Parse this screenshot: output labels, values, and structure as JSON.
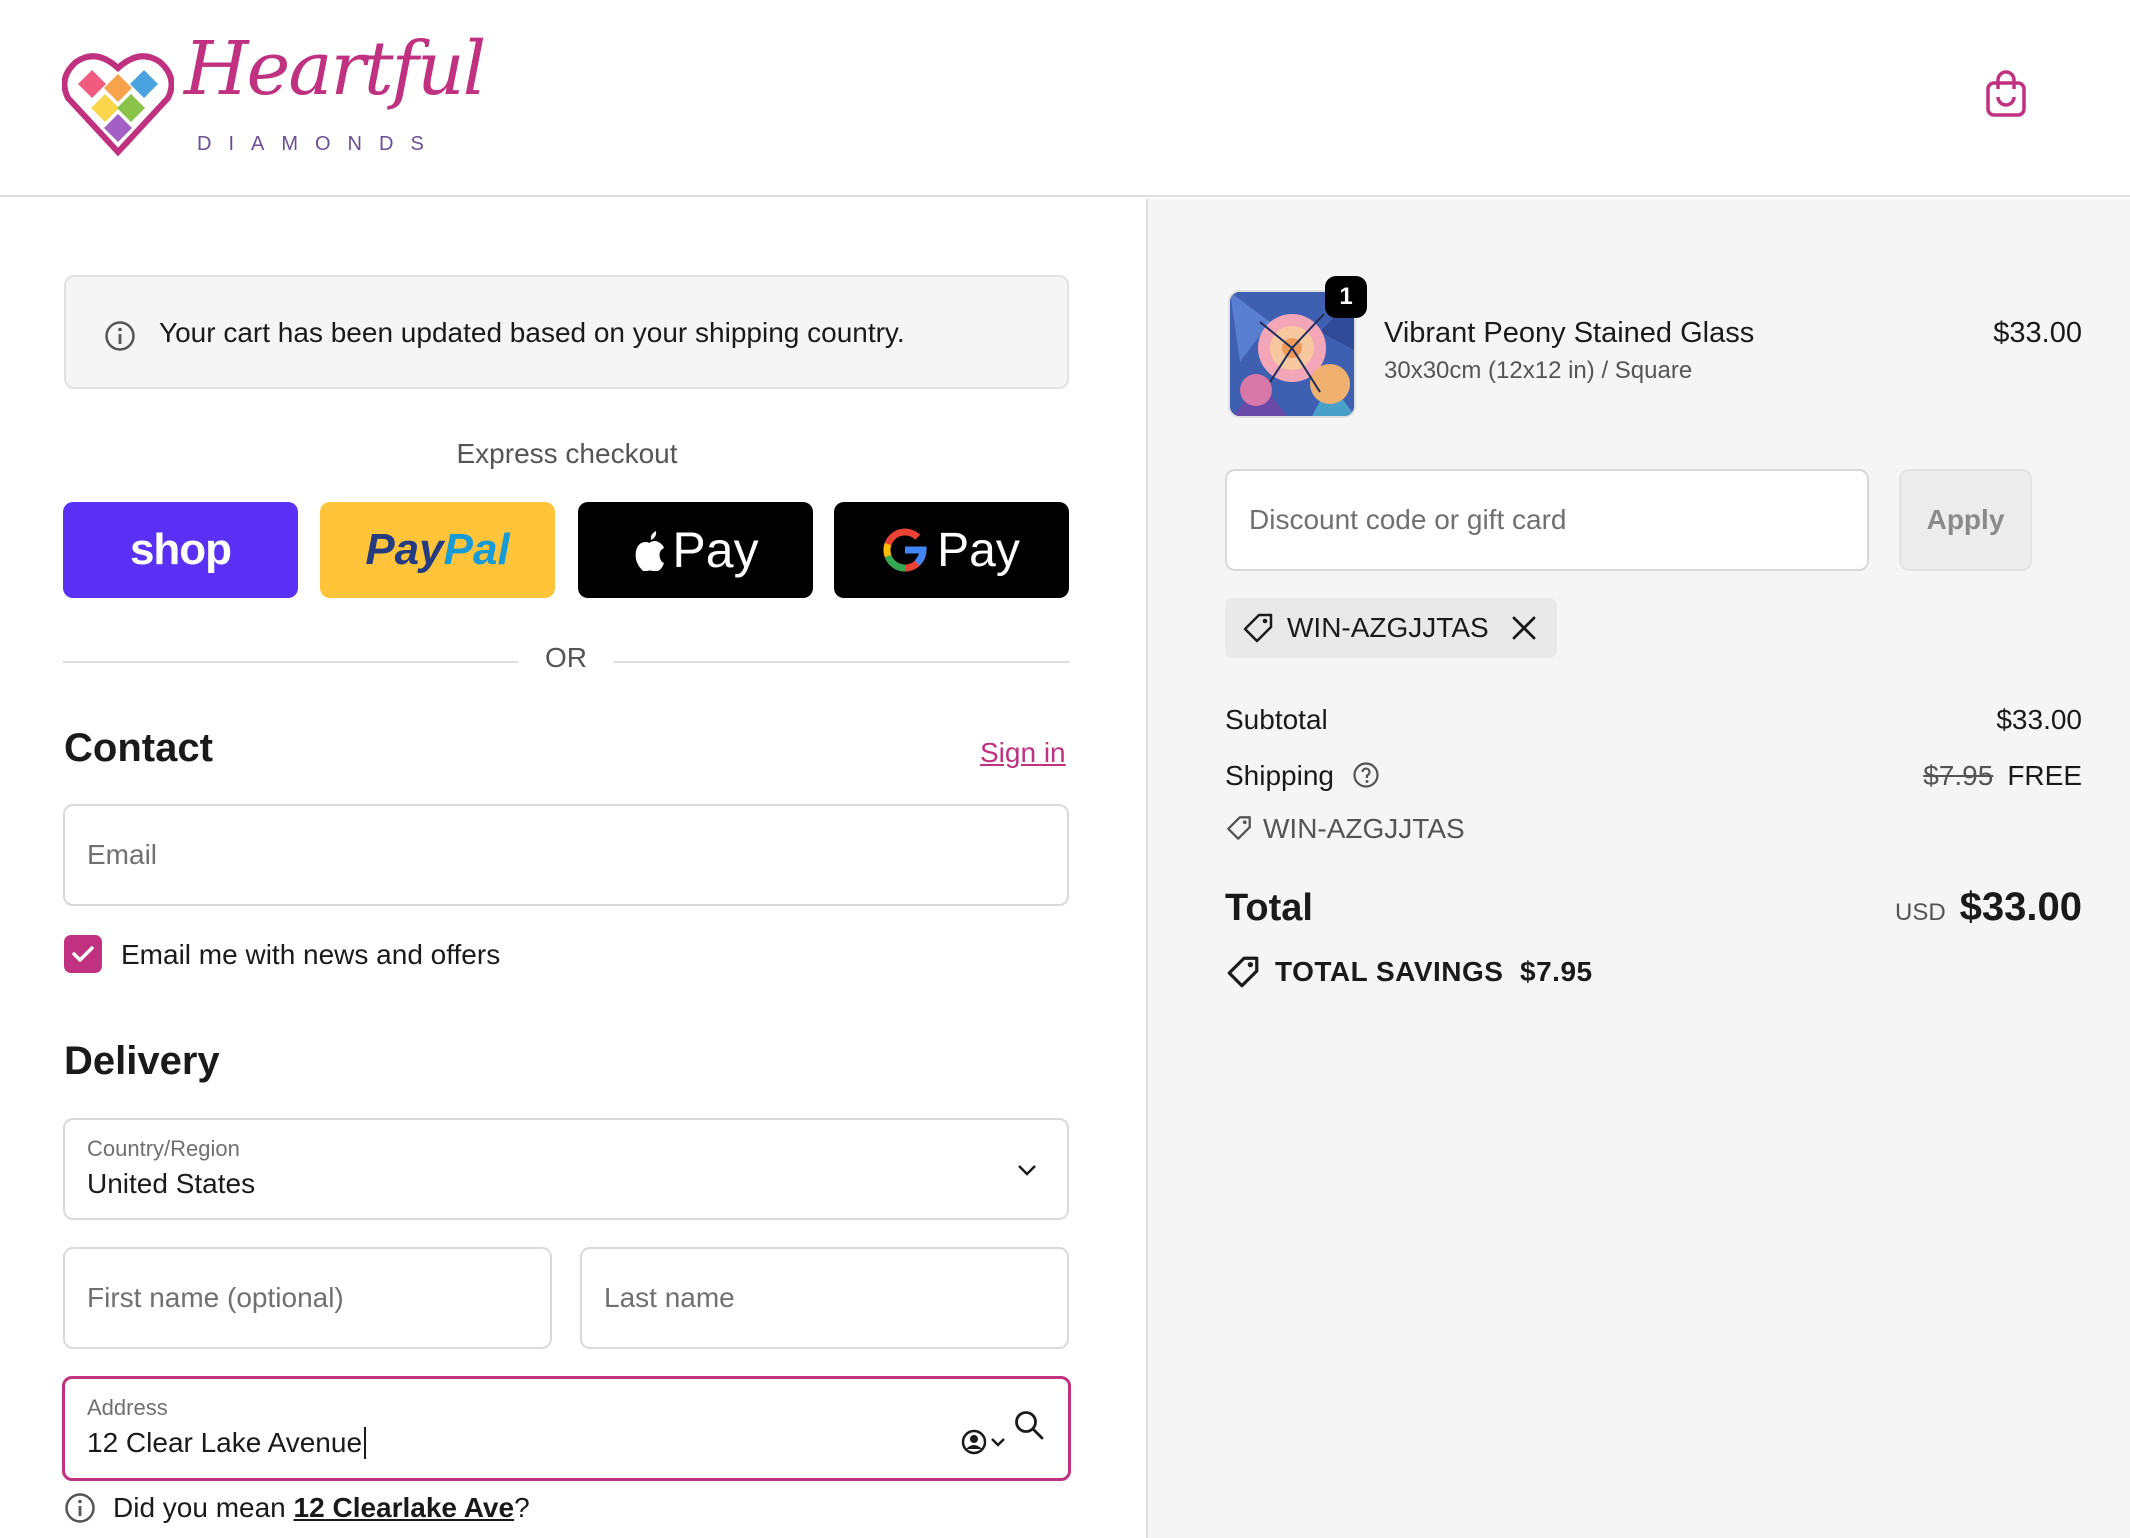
{
  "header": {
    "logo_script": "Heartful",
    "logo_sub": "DIAMONDS",
    "cart_icon": "shopping-bag-icon"
  },
  "notice": {
    "text": "Your cart has been updated based on your shipping country."
  },
  "express": {
    "title": "Express checkout",
    "shop_label": "shop",
    "paypal_a": "Pay",
    "paypal_b": "Pal",
    "apple_label": "Pay",
    "gpay_label": "Pay",
    "or_label": "OR"
  },
  "contact": {
    "heading": "Contact",
    "signin": "Sign in",
    "email_placeholder": "Email",
    "newsletter_label": "Email me with news and offers",
    "newsletter_checked": true
  },
  "delivery": {
    "heading": "Delivery",
    "country_label": "Country/Region",
    "country_value": "United States",
    "first_name_placeholder": "First name (optional)",
    "last_name_placeholder": "Last name",
    "address_label": "Address",
    "address_value": "12 Clear Lake Avenue",
    "suggest_prefix": "Did you mean ",
    "suggest_link": "12 Clearlake Ave",
    "suggest_suffix": "?"
  },
  "order": {
    "item": {
      "name": "Vibrant Peony Stained Glass",
      "variant": "30x30cm (12x12 in) / Square",
      "price": "$33.00",
      "quantity": "1"
    },
    "discount_placeholder": "Discount code or gift card",
    "apply_label": "Apply",
    "applied_code": "WIN-AZGJJTAS",
    "subtotal_label": "Subtotal",
    "subtotal_value": "$33.00",
    "shipping_label": "Shipping",
    "shipping_original": "$7.95",
    "shipping_value": "FREE",
    "shipping_code": "WIN-AZGJJTAS",
    "total_label": "Total",
    "total_currency": "USD",
    "total_value": "$33.00",
    "savings_label": "TOTAL SAVINGS",
    "savings_value": "$7.95"
  },
  "colors": {
    "accent": "#c0317f",
    "shop_bg": "#5a31f4",
    "paypal_bg": "#ffc439",
    "sidebar_bg": "#f5f5f5"
  }
}
